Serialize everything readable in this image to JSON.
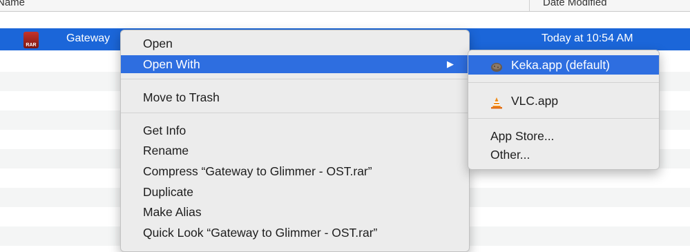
{
  "list_header": {
    "name_label": "Name",
    "date_label": "Date Modified"
  },
  "selected_file": {
    "name": "Gateway",
    "date": "Today at 10:54 AM",
    "icon_label": "RAR"
  },
  "context_menu": {
    "items": [
      "Open",
      "Open With",
      "Move to Trash",
      "Get Info",
      "Rename",
      "Compress “Gateway to Glimmer - OST.rar”",
      "Duplicate",
      "Make Alias",
      "Quick Look “Gateway to Glimmer - OST.rar”"
    ],
    "submenu_arrow": "▶"
  },
  "open_with_submenu": {
    "items": [
      {
        "label": "Keka.app (default)",
        "icon": "keka-icon"
      },
      {
        "label": "VLC.app",
        "icon": "vlc-cone-icon"
      },
      {
        "label": "App Store...",
        "icon": ""
      },
      {
        "label": "Other...",
        "icon": ""
      }
    ]
  },
  "colors": {
    "selection": "#1b66d9",
    "menu_highlight": "#2e6ee0",
    "menu_bg": "#ececec",
    "vlc_orange": "#f08c1a"
  }
}
